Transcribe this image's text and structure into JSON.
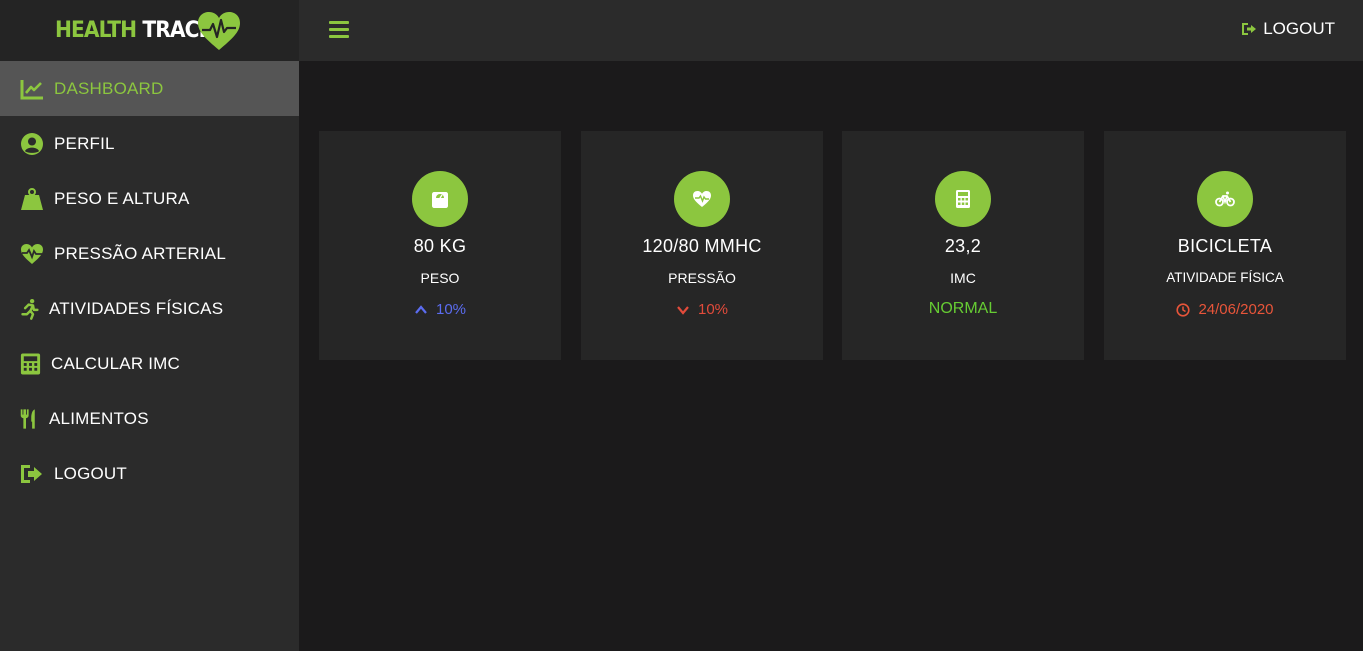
{
  "brand": {
    "part1": "HEALTH",
    "part2": "TRACK",
    "icon": "heart-pulse-icon"
  },
  "header": {
    "menu_icon": "hamburger-icon",
    "logout_label": "LOGOUT",
    "logout_icon": "sign-out-icon"
  },
  "colors": {
    "accent": "#8cc63f",
    "up": "#5b6cf0",
    "down": "#e24b3b",
    "normal": "#66cc33",
    "date": "#e8553a"
  },
  "sidebar": {
    "items": [
      {
        "label": "DASHBOARD",
        "icon": "chart-line-icon",
        "active": true
      },
      {
        "label": "PERFIL",
        "icon": "user-circle-icon"
      },
      {
        "label": "PESO E ALTURA",
        "icon": "weight-icon"
      },
      {
        "label": "PRESSÃO ARTERIAL",
        "icon": "heartbeat-icon"
      },
      {
        "label": "ATIVIDADES FÍSICAS",
        "icon": "running-icon"
      },
      {
        "label": "CALCULAR IMC",
        "icon": "calculator-icon"
      },
      {
        "label": "ALIMENTOS",
        "icon": "utensils-icon"
      },
      {
        "label": "LOGOUT",
        "icon": "sign-out-icon"
      }
    ]
  },
  "cards": [
    {
      "value": "80 KG",
      "label": "PESO",
      "foot": "10%",
      "trend": "up",
      "icon": "scale-icon"
    },
    {
      "value": "120/80 MMHC",
      "label": "PRESSÃO",
      "foot": "10%",
      "trend": "down",
      "icon": "heartbeat-icon"
    },
    {
      "value": "23,2",
      "label": "IMC",
      "foot": "NORMAL",
      "trend": "normal",
      "icon": "calculator-icon"
    },
    {
      "value": "BICICLETA",
      "label": "ATIVIDADE FÍSICA",
      "foot": "24/06/2020",
      "trend": "date",
      "icon": "bicycle-icon"
    }
  ]
}
